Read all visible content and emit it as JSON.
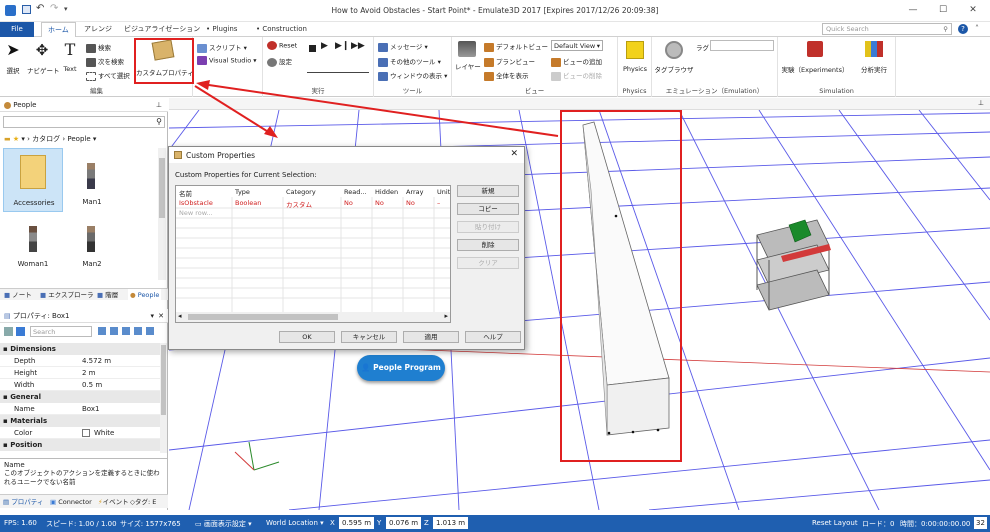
{
  "window": {
    "title": "How to Avoid Obstacles - Start Point* - Emulate3D 2017 [Expires 2017/12/26 20:09:38]"
  },
  "search": {
    "placeholder": "Quick Search"
  },
  "tabs": [
    "File",
    "ホーム",
    "アレンジ",
    "ビジュアライゼーション",
    "Plugins",
    "Construction"
  ],
  "ribbon": {
    "edit": {
      "select": "選択",
      "navigate": "ナビゲート",
      "text": "Text",
      "search": "検索",
      "search_next": "次を検索",
      "select_all": "すべて選択",
      "custom_props": "カスタムプロパティ",
      "label": "編集"
    },
    "script": {
      "script": "スクリプト",
      "vs": "Visual Studio"
    },
    "run": {
      "reset": "Reset",
      "settings": "設定",
      "label": "実行"
    },
    "tools": {
      "messages": "メッセージ",
      "other_tools": "その他のツール",
      "window_display": "ウィンドウの表示",
      "label": "ツール"
    },
    "view": {
      "layer": "レイヤー",
      "default_view": "デフォルトビュー",
      "plan_view": "プランビュー",
      "show_all": "全体を表示",
      "view_dropdown": "Default View",
      "add_view": "ビューの追加",
      "delete_view": "ビューの削除",
      "label": "ビュー"
    },
    "physics": {
      "physics": "Physics",
      "label": "Physics"
    },
    "emulation": {
      "tag_browser": "タグブラウザ",
      "lag": "ラグ",
      "label": "エミュレーション（Emulation）"
    },
    "simulation": {
      "experiments": "実験（Experiments）",
      "distributed": "分析実行",
      "label": "Simulation"
    }
  },
  "people_panel": {
    "title": "People",
    "breadcrumb_catalog": "カタログ",
    "breadcrumb_people": "People",
    "items": [
      "Accessories",
      "Man1",
      "Woman1",
      "Man2"
    ],
    "tabs": [
      "ノート",
      "エクスプローラ",
      "階層",
      "People"
    ]
  },
  "props_panel": {
    "title": "プロパティ: Box1",
    "search_placeholder": "Search",
    "categories": [
      {
        "name": "Dimensions",
        "rows": [
          [
            "Depth",
            "4.572 m"
          ],
          [
            "Height",
            "2 m"
          ],
          [
            "Width",
            "0.5 m"
          ]
        ]
      },
      {
        "name": "General",
        "rows": [
          [
            "Name",
            "Box1"
          ]
        ]
      },
      {
        "name": "Materials",
        "rows": [
          [
            "Color",
            "White"
          ]
        ]
      },
      {
        "name": "Position",
        "rows": []
      }
    ],
    "help_title": "Name",
    "help_text": "このオブジェクトのアクションを定義するときに使われるユニークでない名前",
    "bottom_tabs": [
      "プロパティ",
      "Connector",
      "イベント",
      "タグ: E"
    ]
  },
  "dialog": {
    "title": "Custom Properties",
    "subtitle": "Custom Properties for Current Selection:",
    "columns": [
      "名前",
      "Type",
      "Category",
      "Read...",
      "Hidden",
      "Array",
      "Unit"
    ],
    "rows": [
      [
        "IsObstacle",
        "Boolean",
        "カスタム",
        "No",
        "No",
        "No",
        "–"
      ]
    ],
    "new_row": "New row...",
    "side_buttons": [
      "新規",
      "コピー",
      "貼り付け",
      "削除",
      "クリア"
    ],
    "buttons": [
      "OK",
      "キャンセル",
      "適用",
      "ヘルプ"
    ]
  },
  "viewport": {
    "badge": "People Program"
  },
  "status": {
    "fps": "FPS: 1.60",
    "speed": "スピード: 1.00 / 1.00",
    "size": "サイズ: 1577x765",
    "display": "画面表示設定",
    "location": "World Location",
    "x_label": "X",
    "x": "0.595 m",
    "y_label": "Y",
    "y": "0.076 m",
    "z_label": "Z",
    "z": "1.013 m",
    "reset_layout": "Reset Layout",
    "load": "ロード：0",
    "time": "時間：0:00:00:00.00",
    "badge": "32"
  },
  "colors": {
    "accent": "#1c57a8",
    "status": "#1f5fb0",
    "annotation": "#e02020"
  }
}
